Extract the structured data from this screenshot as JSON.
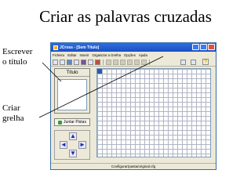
{
  "slide": {
    "title": "Criar as palavras cruzadas",
    "note_title": [
      "Escrever",
      "o título"
    ],
    "note_grid": [
      "Criar",
      "grelha"
    ]
  },
  "window": {
    "title": "JCross - [Sem Título]"
  },
  "menu": [
    "Ficheiro",
    "Editar",
    "Inserir",
    "Organizar a Grelha",
    "Opções",
    "Ajuda"
  ],
  "title_panel": {
    "label": "Título",
    "value": ""
  },
  "join_button": {
    "label": "Juntar Pistas"
  },
  "status": {
    "text": "Configurar/pasta/original.cfg"
  },
  "colors": {
    "titlebar": "#1a4fc4",
    "grid_cursor": "#2a5ab0",
    "arrow": "#1a2aa8"
  }
}
